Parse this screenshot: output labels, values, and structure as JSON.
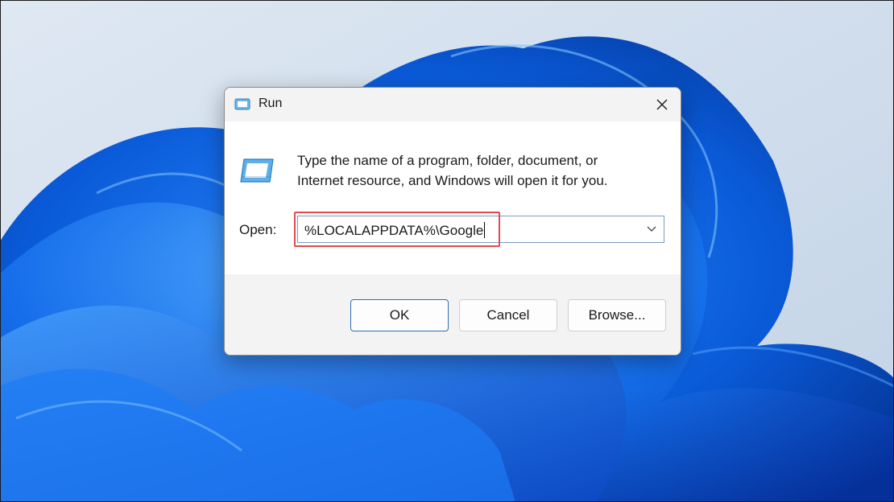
{
  "dialog": {
    "title": "Run",
    "title_icon": "run-icon",
    "close_icon": "close-icon",
    "description_line1": "Type the name of a program, folder, document, or",
    "description_line2": "Internet resource, and Windows will open it for you.",
    "open_label": "Open:",
    "open_value": "%LOCALAPPDATA%\\Google",
    "dropdown_icon": "chevron-down-icon",
    "buttons": {
      "ok": "OK",
      "cancel": "Cancel",
      "browse": "Browse..."
    }
  },
  "colors": {
    "highlight": "#e5484d",
    "accent_border": "#2a6db0",
    "wallpaper_blue": "#0a5ad8"
  }
}
